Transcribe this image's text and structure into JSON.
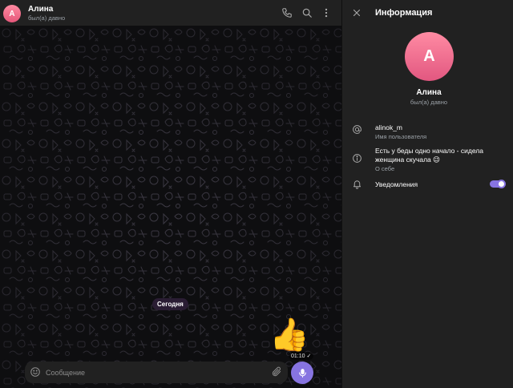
{
  "chat": {
    "contact_name": "Алина",
    "contact_status": "был(а) давно",
    "avatar_letter": "A",
    "date_separator": "Сегодня",
    "sticker_emoji": "👍",
    "message_time": "01:10",
    "message_check": "✓",
    "composer_placeholder": "Сообщение"
  },
  "info_panel": {
    "title": "Информация",
    "avatar_letter": "A",
    "name": "Алина",
    "status": "был(а) давно",
    "username_value": "alinok_m",
    "username_label": "Имя пользователя",
    "bio_value": "Есть у беды одно начало - сидела женщина скучала 😉",
    "bio_label": "О себе",
    "notifications_label": "Уведомления",
    "notifications_on": true
  },
  "colors": {
    "accent": "#8774e1",
    "panel": "#212121",
    "background": "#0e0e10",
    "avatar": "#e5577a"
  },
  "icons": [
    "phone-icon",
    "search-icon",
    "more-vertical-icon",
    "close-icon",
    "at-icon",
    "info-icon",
    "bell-icon",
    "smile-icon",
    "paperclip-icon",
    "microphone-icon"
  ]
}
